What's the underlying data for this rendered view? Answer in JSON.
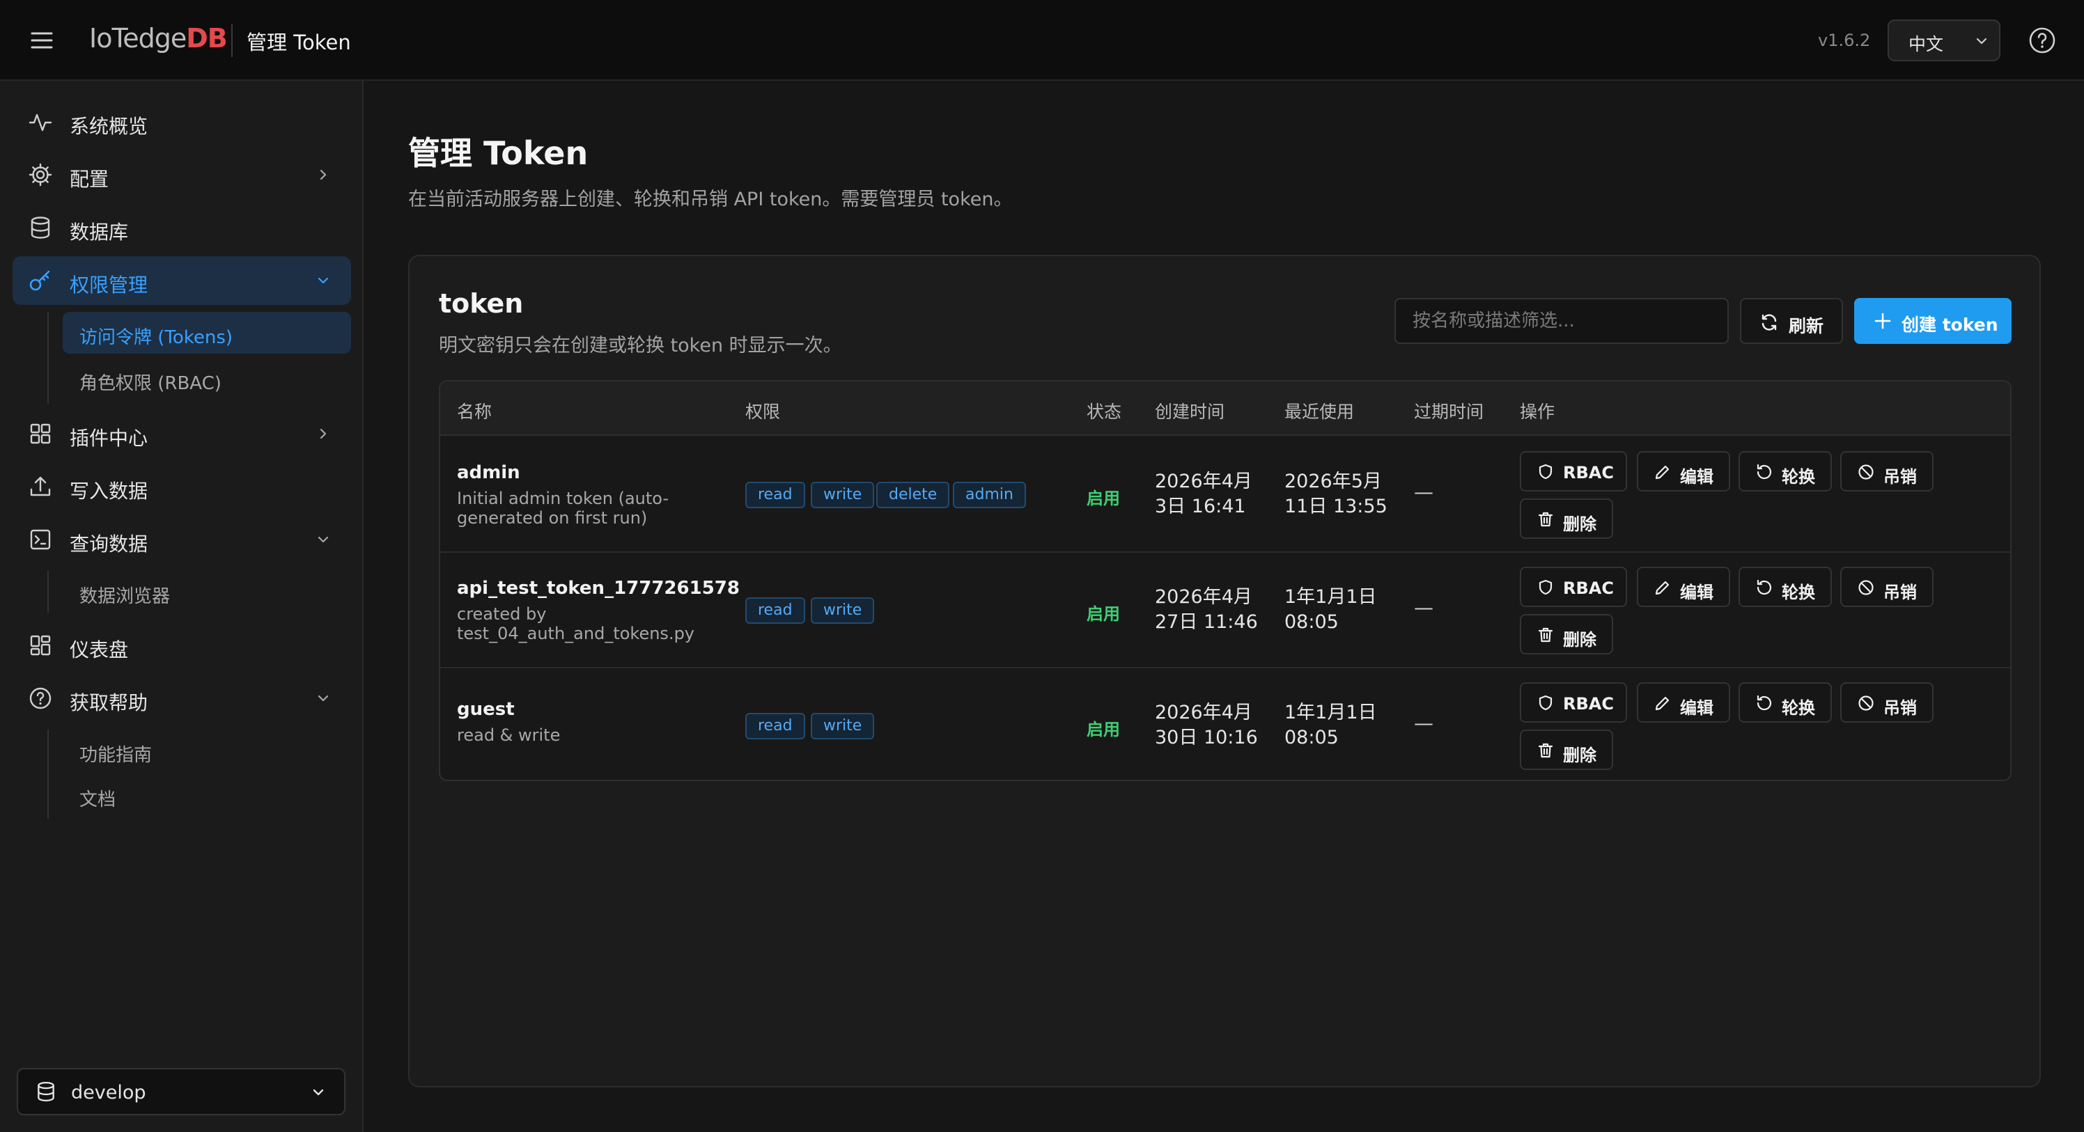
{
  "header": {
    "logo_text": "IoTedge",
    "logo_accent": "DB",
    "title": "管理 Token",
    "version": "v1.6.2",
    "language": "中文"
  },
  "sidebar": {
    "items": [
      {
        "label": "系统概览",
        "icon": "activity-icon"
      },
      {
        "label": "配置",
        "icon": "gear-icon"
      },
      {
        "label": "数据库",
        "icon": "database-icon"
      },
      {
        "label": "权限管理",
        "icon": "key-icon"
      },
      {
        "label": "插件中心",
        "icon": "grid-icon"
      },
      {
        "label": "写入数据",
        "icon": "upload-icon"
      },
      {
        "label": "查询数据",
        "icon": "terminal-icon"
      },
      {
        "label": "仪表盘",
        "icon": "dashboard-icon"
      },
      {
        "label": "获取帮助",
        "icon": "help-circle-icon"
      }
    ],
    "permission_sub": [
      "访问令牌 (Tokens)",
      "角色权限 (RBAC)"
    ],
    "query_sub": [
      "数据浏览器"
    ],
    "help_sub": [
      "功能指南",
      "文档"
    ],
    "database": "develop"
  },
  "main": {
    "title": "管理 Token",
    "description": "在当前活动服务器上创建、轮换和吊销 API token。需要管理员 token。",
    "card": {
      "title": "token",
      "description": "明文密钥只会在创建或轮换 token 时显示一次。",
      "search_placeholder": "按名称或描述筛选...",
      "refresh_label": "刷新",
      "create_label": "创建 token"
    },
    "table": {
      "columns": [
        "名称",
        "权限",
        "状态",
        "创建时间",
        "最近使用",
        "过期时间",
        "操作"
      ],
      "rows": [
        {
          "name": "admin",
          "description": "Initial admin token (auto-generated on first run)",
          "permissions": [
            "read",
            "write",
            "delete",
            "admin"
          ],
          "status": "启用",
          "created_line1": "2026年4月",
          "created_line2": "3日 16:41",
          "last_used_line1": "2026年5月",
          "last_used_line2": "11日 13:55",
          "expires": "—"
        },
        {
          "name": "api_test_token_1777261578",
          "description": "created by test_04_auth_and_tokens.py",
          "permissions": [
            "read",
            "write"
          ],
          "status": "启用",
          "created_line1": "2026年4月",
          "created_line2": "27日 11:46",
          "last_used_line1": "1年1月1日",
          "last_used_line2": "08:05",
          "expires": "—"
        },
        {
          "name": "guest",
          "description": "read & write",
          "permissions": [
            "read",
            "write"
          ],
          "status": "启用",
          "created_line1": "2026年4月",
          "created_line2": "30日 10:16",
          "last_used_line1": "1年1月1日",
          "last_used_line2": "08:05",
          "expires": "—"
        }
      ],
      "actions": {
        "rbac": "RBAC",
        "edit": "编辑",
        "rotate": "轮换",
        "revoke": "吊销",
        "delete": "删除"
      }
    }
  },
  "colors": {
    "accent": "#1f9cf0",
    "active_text": "#3aa0ff",
    "status_enabled": "#3ecf73",
    "logo_accent": "#e5484d"
  }
}
